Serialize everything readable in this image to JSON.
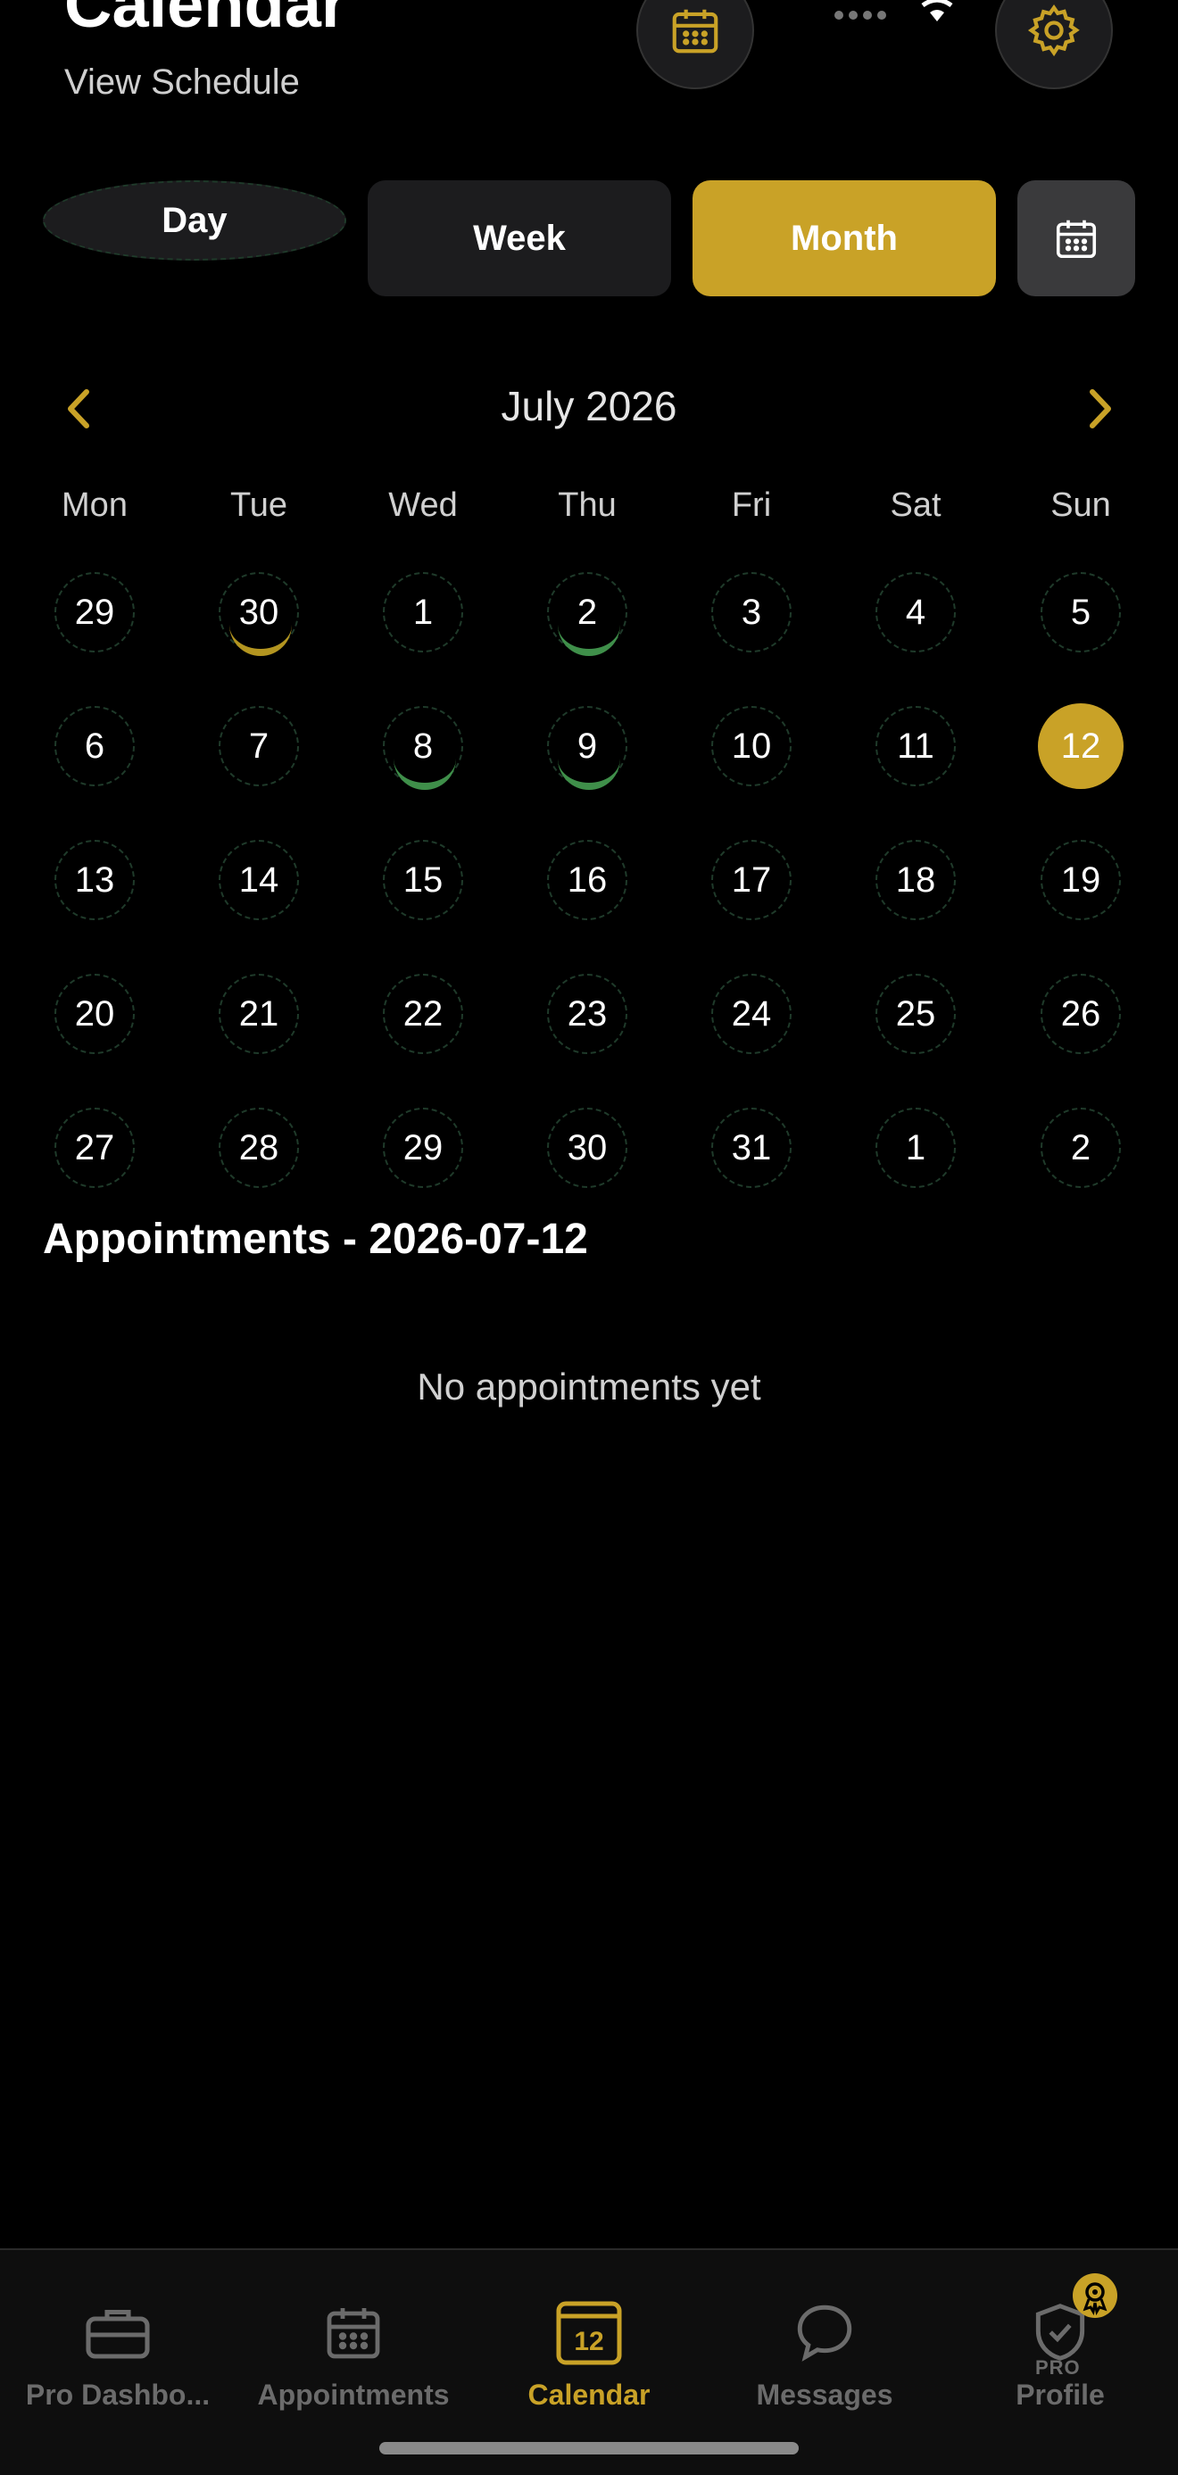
{
  "header": {
    "title": "Calendar",
    "subtitle": "View Schedule",
    "icons": [
      "calendar-icon",
      "gear-icon",
      "wifi-icon"
    ]
  },
  "view_switcher": {
    "options": [
      "Day",
      "Week",
      "Month"
    ],
    "selected": "Month",
    "picker_icon": "calendar-grid-icon"
  },
  "month_nav": {
    "label": "July 2026",
    "prev_icon": "chevron-left-icon",
    "next_icon": "chevron-right-icon"
  },
  "weekdays": [
    "Mon",
    "Tue",
    "Wed",
    "Thu",
    "Fri",
    "Sat",
    "Sun"
  ],
  "weeks": [
    [
      {
        "d": "29"
      },
      {
        "d": "30",
        "mark": "gold"
      },
      {
        "d": "1"
      },
      {
        "d": "2",
        "mark": "green"
      },
      {
        "d": "3"
      },
      {
        "d": "4"
      },
      {
        "d": "5"
      }
    ],
    [
      {
        "d": "6"
      },
      {
        "d": "7"
      },
      {
        "d": "8",
        "mark": "green"
      },
      {
        "d": "9",
        "mark": "green"
      },
      {
        "d": "10"
      },
      {
        "d": "11"
      },
      {
        "d": "12",
        "selected": true
      }
    ],
    [
      {
        "d": "13"
      },
      {
        "d": "14"
      },
      {
        "d": "15"
      },
      {
        "d": "16"
      },
      {
        "d": "17"
      },
      {
        "d": "18"
      },
      {
        "d": "19"
      }
    ],
    [
      {
        "d": "20"
      },
      {
        "d": "21"
      },
      {
        "d": "22"
      },
      {
        "d": "23"
      },
      {
        "d": "24"
      },
      {
        "d": "25"
      },
      {
        "d": "26"
      }
    ],
    [
      {
        "d": "27"
      },
      {
        "d": "28"
      },
      {
        "d": "29"
      },
      {
        "d": "30"
      },
      {
        "d": "31"
      },
      {
        "d": "1"
      },
      {
        "d": "2"
      }
    ]
  ],
  "appointments": {
    "title": "Appointments - 2026-07-12",
    "empty_text": "No appointments yet"
  },
  "tabbar": {
    "items": [
      {
        "label": "Pro Dashbo...",
        "icon": "briefcase-icon"
      },
      {
        "label": "Appointments",
        "icon": "calendar-icon"
      },
      {
        "label": "Calendar",
        "icon": "calendar-day-icon",
        "badge": "12",
        "active": true
      },
      {
        "label": "Messages",
        "icon": "chat-bubble-icon"
      },
      {
        "label": "Profile",
        "icon": "shield-check-icon",
        "tag": "PRO"
      }
    ]
  },
  "colors": {
    "accent": "#c9a227",
    "background": "#000000",
    "marker_green": "#3f8f4a",
    "marker_gold": "#b39520"
  }
}
